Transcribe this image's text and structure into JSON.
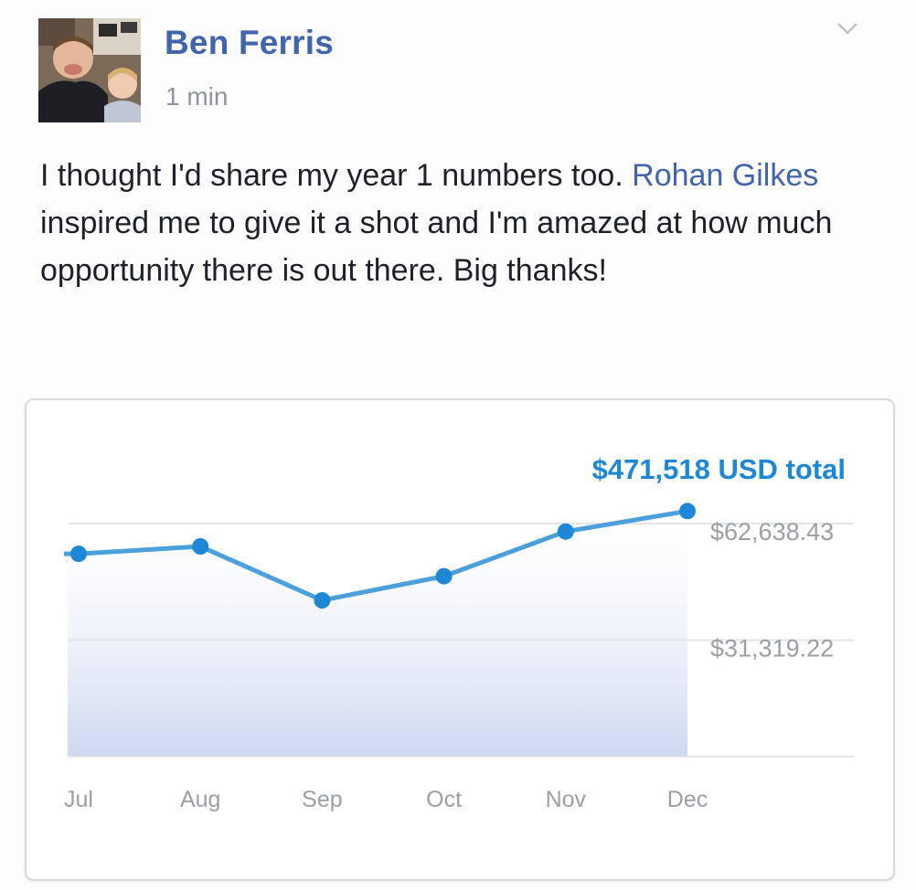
{
  "post": {
    "author": "Ben Ferris",
    "timestamp": "1 min",
    "text_before": "I thought I'd share my year 1 numbers too. ",
    "mention": "Rohan Gilkes",
    "text_after": " inspired me to give it a shot and I'm amazed at how much opportunity there is out there. Big thanks!",
    "avatar_icon": "profile-photo",
    "menu_icon": "chevron-down-icon"
  },
  "colors": {
    "author": "#4064ad",
    "line": "#4aa0dc",
    "point": "#1e88d6",
    "total": "#1e88d6",
    "area": "#c7d3ee"
  },
  "chart_data": {
    "type": "line",
    "title": "$471,518 USD total",
    "categories": [
      "Jul",
      "Aug",
      "Sep",
      "Oct",
      "Nov",
      "Dec"
    ],
    "series": [
      {
        "values": [
          54500,
          56500,
          42000,
          48500,
          60500,
          66000
        ]
      }
    ],
    "y_tick_labels": [
      "$62,638.43",
      "$31,319.22"
    ],
    "y_ticks": [
      62638.43,
      31319.22
    ],
    "ylim": [
      0,
      62638.43
    ],
    "grid": true,
    "legend": "none"
  }
}
